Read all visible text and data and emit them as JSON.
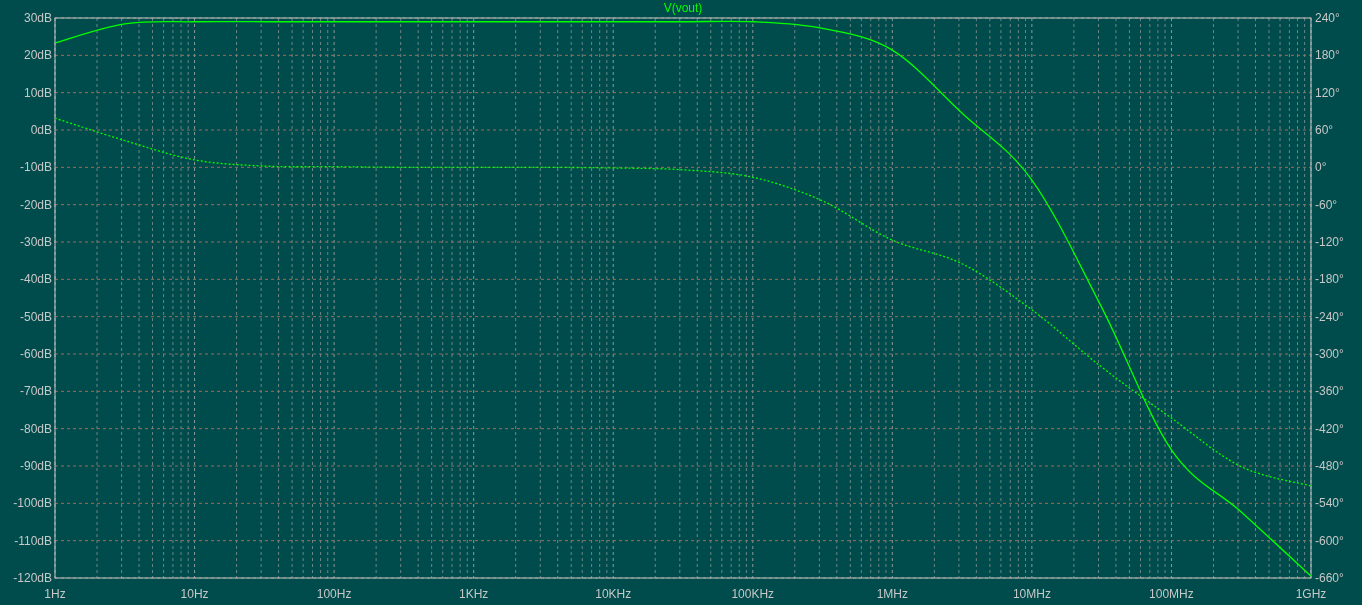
{
  "plot": {
    "chart_data": {
      "type": "line",
      "grid": true,
      "categories": [
        "1Hz",
        null,
        "10Hz",
        null,
        "100Hz",
        null,
        "1KHz",
        null,
        "10KHz",
        null,
        "100KHz",
        null,
        "1MHz",
        null,
        "10MHz",
        null,
        "100MHz",
        null,
        "1GHz"
      ],
      "series": [
        {
          "name": "V(vout)",
          "color": "#00ff00",
          "values": [
            23.3,
            28.4,
            29,
            29,
            29,
            29,
            29,
            29,
            29,
            29,
            29,
            27.2,
            21.4,
            4.5,
            -13.4,
            -47.5,
            -85.7,
            -102.3,
            -119.5
          ]
        },
        {
          "axis": "y2",
          "line_style": "dotted",
          "color": "#00ff00",
          "values": [
            79,
            43,
            12,
            2,
            1,
            0,
            0,
            0,
            -1,
            -4,
            -16,
            -54,
            -117,
            -155,
            -229,
            -321,
            -403,
            -481,
            -512
          ]
        }
      ],
      "ylim": [
        -120,
        30
      ],
      "yticks": [
        {
          "value": 30,
          "label": "30dB"
        },
        {
          "value": 20,
          "label": "20dB"
        },
        {
          "value": 10,
          "label": "10dB"
        },
        {
          "value": 0,
          "label": "0dB"
        },
        {
          "value": -10,
          "label": "-10dB"
        },
        {
          "value": -20,
          "label": "-20dB"
        },
        {
          "value": -30,
          "label": "-30dB"
        },
        {
          "value": -40,
          "label": "-40dB"
        },
        {
          "value": -50,
          "label": "-50dB"
        },
        {
          "value": -60,
          "label": "-60dB"
        },
        {
          "value": -70,
          "label": "-70dB"
        },
        {
          "value": -80,
          "label": "-80dB"
        },
        {
          "value": -90,
          "label": "-90dB"
        },
        {
          "value": -100,
          "label": "-100dB"
        },
        {
          "value": -110,
          "label": "-110dB"
        },
        {
          "value": -120,
          "label": "-120dB"
        }
      ],
      "y2lim": [
        -660,
        240
      ],
      "y2ticks": [
        {
          "value": 240,
          "label": "240°"
        },
        {
          "value": 180,
          "label": "180°"
        },
        {
          "value": 120,
          "label": "120°"
        },
        {
          "value": 60,
          "label": "60°"
        },
        {
          "value": 0,
          "label": "0°"
        },
        {
          "value": -60,
          "label": "-60°"
        },
        {
          "value": -120,
          "label": "-120°"
        },
        {
          "value": -180,
          "label": "-180°"
        },
        {
          "value": -240,
          "label": "-240°"
        },
        {
          "value": -300,
          "label": "-300°"
        },
        {
          "value": -360,
          "label": "-360°"
        },
        {
          "value": -420,
          "label": "-420°"
        },
        {
          "value": -480,
          "label": "-480°"
        },
        {
          "value": -540,
          "label": "-540°"
        },
        {
          "value": -600,
          "label": "-600°"
        },
        {
          "value": -660,
          "label": "-660°"
        }
      ]
    }
  }
}
